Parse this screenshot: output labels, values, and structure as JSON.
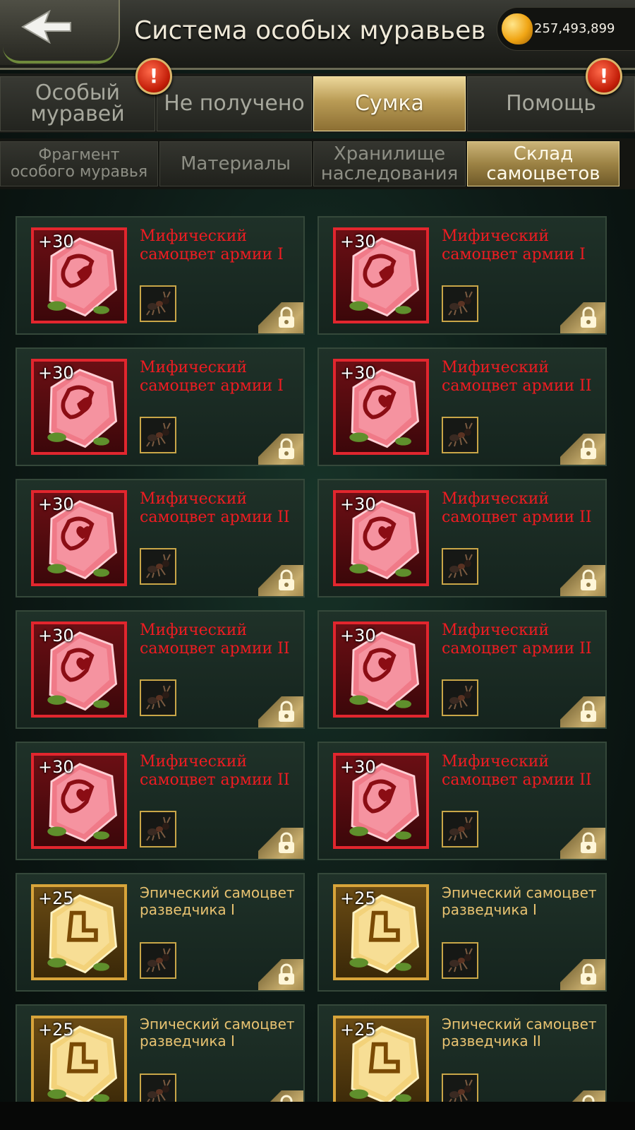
{
  "header": {
    "back_icon": "back-arrow-icon",
    "title": "Система особых муравьев",
    "currency_icon": "amber-icon",
    "currency_value": "257,493,899"
  },
  "tabs_primary": [
    {
      "label": "Особый\nмуравей",
      "active": false,
      "alert": true
    },
    {
      "label": "Не получено",
      "active": false,
      "alert": false
    },
    {
      "label": "Сумка",
      "active": true,
      "alert": false
    },
    {
      "label": "Помощь",
      "active": false,
      "alert": true
    }
  ],
  "alert_symbol": "!",
  "tabs_secondary": [
    {
      "label": "Фрагмент\nособого муравья",
      "active": false
    },
    {
      "label": "Материалы",
      "active": false
    },
    {
      "label": "Хранилище\nнаследования",
      "active": false
    },
    {
      "label": "Склад\nсамоцветов",
      "active": true
    }
  ],
  "items": [
    {
      "name": "Мифический самоцвет армии I",
      "bonus": "+30",
      "rarity": "mythic",
      "gem_icon": "shield-rune-icon",
      "ant_icon": "black-ant-icon",
      "lock_icon": "lock-icon"
    },
    {
      "name": "Мифический самоцвет армии I",
      "bonus": "+30",
      "rarity": "mythic",
      "gem_icon": "shield-rune-icon",
      "ant_icon": "dark-ant-icon",
      "lock_icon": "lock-icon"
    },
    {
      "name": "Мифический самоцвет армии I",
      "bonus": "+30",
      "rarity": "mythic",
      "gem_icon": "shield-rune-icon",
      "ant_icon": "yellow-ant-icon",
      "lock_icon": "lock-icon"
    },
    {
      "name": "Мифический самоцвет армии II",
      "bonus": "+30",
      "rarity": "mythic",
      "gem_icon": "heart-rune-icon",
      "ant_icon": "armored-ant-icon",
      "lock_icon": "lock-icon"
    },
    {
      "name": "Мифический самоцвет армии II",
      "bonus": "+30",
      "rarity": "mythic",
      "gem_icon": "heart-rune-icon",
      "ant_icon": "wasp-ant-icon",
      "lock_icon": "lock-icon"
    },
    {
      "name": "Мифический самоцвет армии II",
      "bonus": "+30",
      "rarity": "mythic",
      "gem_icon": "heart-rune-icon",
      "ant_icon": "orange-ant-icon",
      "lock_icon": "lock-icon"
    },
    {
      "name": "Мифический самоцвет армии II",
      "bonus": "+30",
      "rarity": "mythic",
      "gem_icon": "heart-rune-icon",
      "ant_icon": "blue-red-ant-icon",
      "lock_icon": "lock-icon"
    },
    {
      "name": "Мифический самоцвет армии II",
      "bonus": "+30",
      "rarity": "mythic",
      "gem_icon": "heart-rune-icon",
      "ant_icon": "slender-ant-icon",
      "lock_icon": "lock-icon"
    },
    {
      "name": "Мифический самоцвет армии II",
      "bonus": "+30",
      "rarity": "mythic",
      "gem_icon": "heart-rune-icon",
      "ant_icon": "red-ant-icon",
      "lock_icon": "lock-icon"
    },
    {
      "name": "Мифический самоцвет армии II",
      "bonus": "+30",
      "rarity": "mythic",
      "gem_icon": "heart-rune-icon",
      "ant_icon": "black-ant-icon",
      "lock_icon": "lock-icon"
    },
    {
      "name": "Эпический самоцвет разведчика I",
      "bonus": "+25",
      "rarity": "epic",
      "gem_icon": "boot-rune-icon",
      "ant_icon": "red-ant-icon",
      "lock_icon": "lock-icon"
    },
    {
      "name": "Эпический самоцвет разведчика I",
      "bonus": "+25",
      "rarity": "epic",
      "gem_icon": "boot-rune-icon",
      "ant_icon": "black-ant-icon",
      "lock_icon": "lock-icon"
    },
    {
      "name": "Эпический самоцвет разведчика I",
      "bonus": "+25",
      "rarity": "epic",
      "gem_icon": "boot-rune-icon",
      "ant_icon": "red-ant-icon",
      "lock_icon": "lock-icon"
    },
    {
      "name": "Эпический самоцвет разведчика II",
      "bonus": "+25",
      "rarity": "epic",
      "gem_icon": "boot-rune-icon",
      "ant_icon": "black-ant-icon",
      "lock_icon": "lock-icon"
    }
  ],
  "colors": {
    "mythic_name": "#ee1c22",
    "mythic_frame": "#e2262e",
    "epic_name": "#e9c371",
    "epic_frame": "#d8a43a",
    "active_tab": "#b99b55"
  }
}
